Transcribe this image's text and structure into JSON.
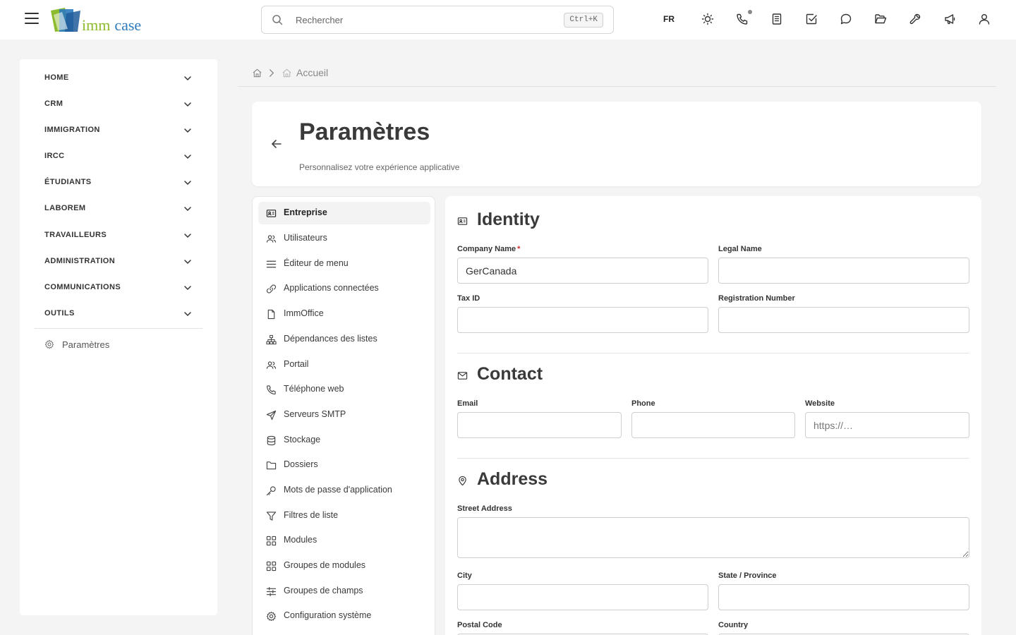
{
  "topbar": {
    "logo": {
      "part1": "imm",
      "part2": "case"
    },
    "search": {
      "placeholder": "Rechercher",
      "shortcut": "Ctrl+K"
    },
    "language": "FR",
    "icons": [
      "sun-icon",
      "phone-icon",
      "notes-icon",
      "checkbox-icon",
      "chat-icon",
      "folder-open-icon",
      "wrench-icon",
      "megaphone-icon",
      "user-icon"
    ]
  },
  "sidebar": {
    "items": [
      {
        "label": "HOME"
      },
      {
        "label": "CRM"
      },
      {
        "label": "IMMIGRATION"
      },
      {
        "label": "IRCC"
      },
      {
        "label": "ÉTUDIANTS"
      },
      {
        "label": "LABOREM"
      },
      {
        "label": "TRAVAILLEURS"
      },
      {
        "label": "ADMINISTRATION"
      },
      {
        "label": "COMMUNICATIONS"
      },
      {
        "label": "OUTILS"
      }
    ],
    "settings_label": "Paramètres"
  },
  "breadcrumb": {
    "current": "Accueil"
  },
  "page": {
    "title": "Paramètres",
    "subtitle": "Personnalisez votre expérience applicative"
  },
  "settings_nav": {
    "items": [
      {
        "label": "Entreprise",
        "icon": "id-card-icon",
        "active": true
      },
      {
        "label": "Utilisateurs",
        "icon": "users-icon"
      },
      {
        "label": "Éditeur de menu",
        "icon": "menu-lines-icon"
      },
      {
        "label": "Applications connectées",
        "icon": "link-icon"
      },
      {
        "label": "ImmOffice",
        "icon": "file-icon"
      },
      {
        "label": "Dépendances des listes",
        "icon": "hierarchy-icon"
      },
      {
        "label": "Portail",
        "icon": "users-icon"
      },
      {
        "label": "Téléphone web",
        "icon": "phone-icon"
      },
      {
        "label": "Serveurs SMTP",
        "icon": "send-icon"
      },
      {
        "label": "Stockage",
        "icon": "database-icon"
      },
      {
        "label": "Dossiers",
        "icon": "folder-icon"
      },
      {
        "label": "Mots de passe d'application",
        "icon": "key-icon"
      },
      {
        "label": "Filtres de liste",
        "icon": "filter-icon"
      },
      {
        "label": "Modules",
        "icon": "grid-icon"
      },
      {
        "label": "Groupes de modules",
        "icon": "grid-icon"
      },
      {
        "label": "Groupes de champs",
        "icon": "sliders-icon"
      },
      {
        "label": "Configuration système",
        "icon": "gear-icon"
      }
    ]
  },
  "form": {
    "identity": {
      "title": "Identity",
      "company_name": {
        "label": "Company Name",
        "required_mark": "*",
        "value": "GerCanada"
      },
      "legal_name": {
        "label": "Legal Name",
        "value": ""
      },
      "tax_id": {
        "label": "Tax ID",
        "value": ""
      },
      "registration_number": {
        "label": "Registration Number",
        "value": ""
      }
    },
    "contact": {
      "title": "Contact",
      "email": {
        "label": "Email",
        "value": ""
      },
      "phone": {
        "label": "Phone",
        "value": ""
      },
      "website": {
        "label": "Website",
        "value": "",
        "placeholder": "https://…"
      }
    },
    "address": {
      "title": "Address",
      "street": {
        "label": "Street Address",
        "value": ""
      },
      "city": {
        "label": "City",
        "value": ""
      },
      "state": {
        "label": "State / Province",
        "value": ""
      },
      "postal_code": {
        "label": "Postal Code"
      },
      "country": {
        "label": "Country"
      }
    }
  }
}
